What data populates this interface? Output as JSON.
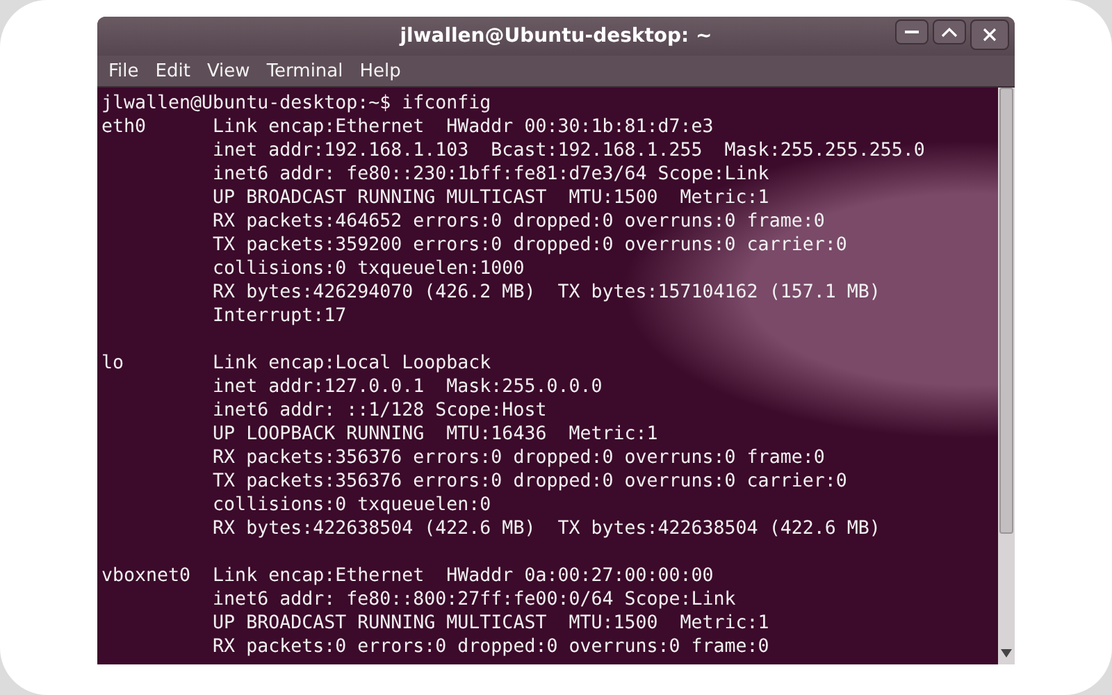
{
  "window": {
    "title": "jlwallen@Ubuntu-desktop: ~"
  },
  "menu": [
    {
      "label": "File"
    },
    {
      "label": "Edit"
    },
    {
      "label": "View"
    },
    {
      "label": "Terminal"
    },
    {
      "label": "Help"
    }
  ],
  "terminal": {
    "prompt": "jlwallen@Ubuntu-desktop:~$ ifconfig",
    "interfaces": [
      {
        "name": "eth0",
        "lines": [
          "Link encap:Ethernet  HWaddr 00:30:1b:81:d7:e3",
          "inet addr:192.168.1.103  Bcast:192.168.1.255  Mask:255.255.255.0",
          "inet6 addr: fe80::230:1bff:fe81:d7e3/64 Scope:Link",
          "UP BROADCAST RUNNING MULTICAST  MTU:1500  Metric:1",
          "RX packets:464652 errors:0 dropped:0 overruns:0 frame:0",
          "TX packets:359200 errors:0 dropped:0 overruns:0 carrier:0",
          "collisions:0 txqueuelen:1000",
          "RX bytes:426294070 (426.2 MB)  TX bytes:157104162 (157.1 MB)",
          "Interrupt:17"
        ]
      },
      {
        "name": "lo",
        "lines": [
          "Link encap:Local Loopback",
          "inet addr:127.0.0.1  Mask:255.0.0.0",
          "inet6 addr: ::1/128 Scope:Host",
          "UP LOOPBACK RUNNING  MTU:16436  Metric:1",
          "RX packets:356376 errors:0 dropped:0 overruns:0 frame:0",
          "TX packets:356376 errors:0 dropped:0 overruns:0 carrier:0",
          "collisions:0 txqueuelen:0",
          "RX bytes:422638504 (422.6 MB)  TX bytes:422638504 (422.6 MB)"
        ]
      },
      {
        "name": "vboxnet0",
        "lines": [
          "Link encap:Ethernet  HWaddr 0a:00:27:00:00:00",
          "inet6 addr: fe80::800:27ff:fe00:0/64 Scope:Link",
          "UP BROADCAST RUNNING MULTICAST  MTU:1500  Metric:1",
          "RX packets:0 errors:0 dropped:0 overruns:0 frame:0"
        ]
      }
    ]
  }
}
